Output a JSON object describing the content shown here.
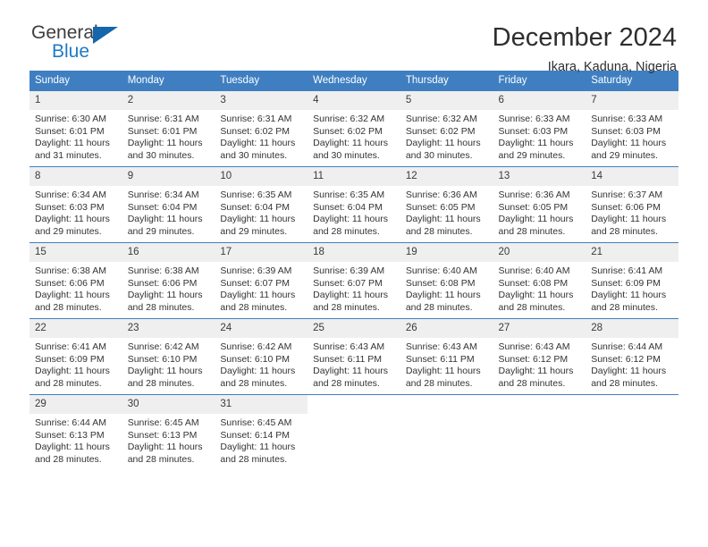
{
  "brand": {
    "name_part1": "General",
    "name_part2": "Blue",
    "triangle_icon": "triangle-icon",
    "accent_color": "#1566ad",
    "blue_text_color": "#1f7ac4"
  },
  "header": {
    "title": "December 2024",
    "subtitle": "Ikara, Kaduna, Nigeria"
  },
  "calendar": {
    "header_bg": "#3f7fc1",
    "daynum_bg": "#efefef",
    "weekdays": [
      "Sunday",
      "Monday",
      "Tuesday",
      "Wednesday",
      "Thursday",
      "Friday",
      "Saturday"
    ],
    "labels": {
      "sunrise": "Sunrise:",
      "sunset": "Sunset:",
      "daylight": "Daylight:"
    },
    "weeks": [
      [
        {
          "day": "1",
          "sunrise": "Sunrise: 6:30 AM",
          "sunset": "Sunset: 6:01 PM",
          "daylight1": "Daylight: 11 hours",
          "daylight2": "and 31 minutes."
        },
        {
          "day": "2",
          "sunrise": "Sunrise: 6:31 AM",
          "sunset": "Sunset: 6:01 PM",
          "daylight1": "Daylight: 11 hours",
          "daylight2": "and 30 minutes."
        },
        {
          "day": "3",
          "sunrise": "Sunrise: 6:31 AM",
          "sunset": "Sunset: 6:02 PM",
          "daylight1": "Daylight: 11 hours",
          "daylight2": "and 30 minutes."
        },
        {
          "day": "4",
          "sunrise": "Sunrise: 6:32 AM",
          "sunset": "Sunset: 6:02 PM",
          "daylight1": "Daylight: 11 hours",
          "daylight2": "and 30 minutes."
        },
        {
          "day": "5",
          "sunrise": "Sunrise: 6:32 AM",
          "sunset": "Sunset: 6:02 PM",
          "daylight1": "Daylight: 11 hours",
          "daylight2": "and 30 minutes."
        },
        {
          "day": "6",
          "sunrise": "Sunrise: 6:33 AM",
          "sunset": "Sunset: 6:03 PM",
          "daylight1": "Daylight: 11 hours",
          "daylight2": "and 29 minutes."
        },
        {
          "day": "7",
          "sunrise": "Sunrise: 6:33 AM",
          "sunset": "Sunset: 6:03 PM",
          "daylight1": "Daylight: 11 hours",
          "daylight2": "and 29 minutes."
        }
      ],
      [
        {
          "day": "8",
          "sunrise": "Sunrise: 6:34 AM",
          "sunset": "Sunset: 6:03 PM",
          "daylight1": "Daylight: 11 hours",
          "daylight2": "and 29 minutes."
        },
        {
          "day": "9",
          "sunrise": "Sunrise: 6:34 AM",
          "sunset": "Sunset: 6:04 PM",
          "daylight1": "Daylight: 11 hours",
          "daylight2": "and 29 minutes."
        },
        {
          "day": "10",
          "sunrise": "Sunrise: 6:35 AM",
          "sunset": "Sunset: 6:04 PM",
          "daylight1": "Daylight: 11 hours",
          "daylight2": "and 29 minutes."
        },
        {
          "day": "11",
          "sunrise": "Sunrise: 6:35 AM",
          "sunset": "Sunset: 6:04 PM",
          "daylight1": "Daylight: 11 hours",
          "daylight2": "and 28 minutes."
        },
        {
          "day": "12",
          "sunrise": "Sunrise: 6:36 AM",
          "sunset": "Sunset: 6:05 PM",
          "daylight1": "Daylight: 11 hours",
          "daylight2": "and 28 minutes."
        },
        {
          "day": "13",
          "sunrise": "Sunrise: 6:36 AM",
          "sunset": "Sunset: 6:05 PM",
          "daylight1": "Daylight: 11 hours",
          "daylight2": "and 28 minutes."
        },
        {
          "day": "14",
          "sunrise": "Sunrise: 6:37 AM",
          "sunset": "Sunset: 6:06 PM",
          "daylight1": "Daylight: 11 hours",
          "daylight2": "and 28 minutes."
        }
      ],
      [
        {
          "day": "15",
          "sunrise": "Sunrise: 6:38 AM",
          "sunset": "Sunset: 6:06 PM",
          "daylight1": "Daylight: 11 hours",
          "daylight2": "and 28 minutes."
        },
        {
          "day": "16",
          "sunrise": "Sunrise: 6:38 AM",
          "sunset": "Sunset: 6:06 PM",
          "daylight1": "Daylight: 11 hours",
          "daylight2": "and 28 minutes."
        },
        {
          "day": "17",
          "sunrise": "Sunrise: 6:39 AM",
          "sunset": "Sunset: 6:07 PM",
          "daylight1": "Daylight: 11 hours",
          "daylight2": "and 28 minutes."
        },
        {
          "day": "18",
          "sunrise": "Sunrise: 6:39 AM",
          "sunset": "Sunset: 6:07 PM",
          "daylight1": "Daylight: 11 hours",
          "daylight2": "and 28 minutes."
        },
        {
          "day": "19",
          "sunrise": "Sunrise: 6:40 AM",
          "sunset": "Sunset: 6:08 PM",
          "daylight1": "Daylight: 11 hours",
          "daylight2": "and 28 minutes."
        },
        {
          "day": "20",
          "sunrise": "Sunrise: 6:40 AM",
          "sunset": "Sunset: 6:08 PM",
          "daylight1": "Daylight: 11 hours",
          "daylight2": "and 28 minutes."
        },
        {
          "day": "21",
          "sunrise": "Sunrise: 6:41 AM",
          "sunset": "Sunset: 6:09 PM",
          "daylight1": "Daylight: 11 hours",
          "daylight2": "and 28 minutes."
        }
      ],
      [
        {
          "day": "22",
          "sunrise": "Sunrise: 6:41 AM",
          "sunset": "Sunset: 6:09 PM",
          "daylight1": "Daylight: 11 hours",
          "daylight2": "and 28 minutes."
        },
        {
          "day": "23",
          "sunrise": "Sunrise: 6:42 AM",
          "sunset": "Sunset: 6:10 PM",
          "daylight1": "Daylight: 11 hours",
          "daylight2": "and 28 minutes."
        },
        {
          "day": "24",
          "sunrise": "Sunrise: 6:42 AM",
          "sunset": "Sunset: 6:10 PM",
          "daylight1": "Daylight: 11 hours",
          "daylight2": "and 28 minutes."
        },
        {
          "day": "25",
          "sunrise": "Sunrise: 6:43 AM",
          "sunset": "Sunset: 6:11 PM",
          "daylight1": "Daylight: 11 hours",
          "daylight2": "and 28 minutes."
        },
        {
          "day": "26",
          "sunrise": "Sunrise: 6:43 AM",
          "sunset": "Sunset: 6:11 PM",
          "daylight1": "Daylight: 11 hours",
          "daylight2": "and 28 minutes."
        },
        {
          "day": "27",
          "sunrise": "Sunrise: 6:43 AM",
          "sunset": "Sunset: 6:12 PM",
          "daylight1": "Daylight: 11 hours",
          "daylight2": "and 28 minutes."
        },
        {
          "day": "28",
          "sunrise": "Sunrise: 6:44 AM",
          "sunset": "Sunset: 6:12 PM",
          "daylight1": "Daylight: 11 hours",
          "daylight2": "and 28 minutes."
        }
      ],
      [
        {
          "day": "29",
          "sunrise": "Sunrise: 6:44 AM",
          "sunset": "Sunset: 6:13 PM",
          "daylight1": "Daylight: 11 hours",
          "daylight2": "and 28 minutes."
        },
        {
          "day": "30",
          "sunrise": "Sunrise: 6:45 AM",
          "sunset": "Sunset: 6:13 PM",
          "daylight1": "Daylight: 11 hours",
          "daylight2": "and 28 minutes."
        },
        {
          "day": "31",
          "sunrise": "Sunrise: 6:45 AM",
          "sunset": "Sunset: 6:14 PM",
          "daylight1": "Daylight: 11 hours",
          "daylight2": "and 28 minutes."
        },
        {
          "day": "",
          "sunrise": "",
          "sunset": "",
          "daylight1": "",
          "daylight2": ""
        },
        {
          "day": "",
          "sunrise": "",
          "sunset": "",
          "daylight1": "",
          "daylight2": ""
        },
        {
          "day": "",
          "sunrise": "",
          "sunset": "",
          "daylight1": "",
          "daylight2": ""
        },
        {
          "day": "",
          "sunrise": "",
          "sunset": "",
          "daylight1": "",
          "daylight2": ""
        }
      ]
    ]
  }
}
